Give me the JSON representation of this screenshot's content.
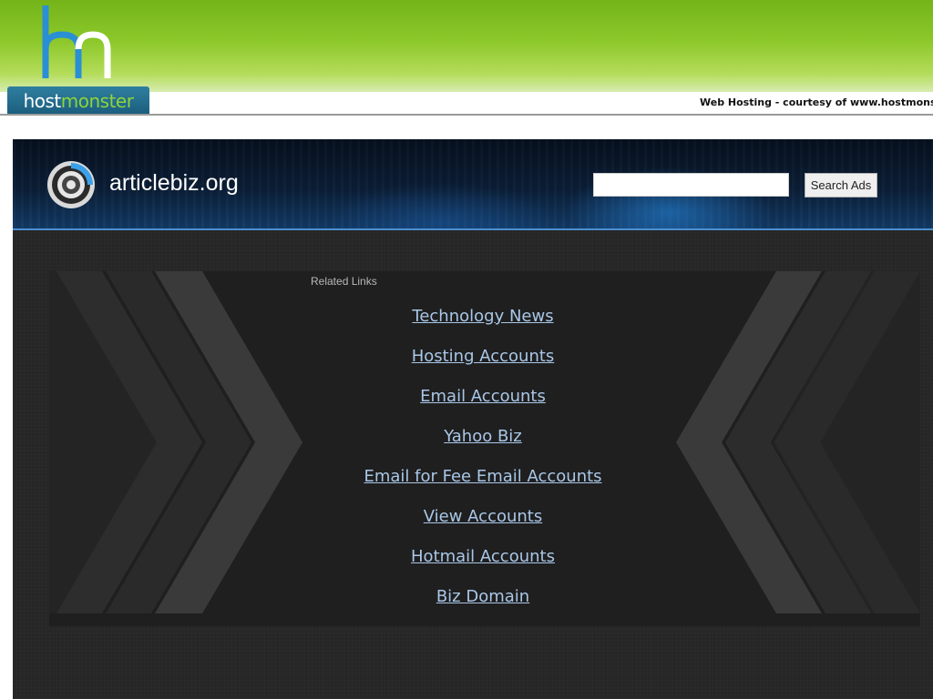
{
  "host_banner": {
    "logo_word_host": "host",
    "logo_word_monster": "monster",
    "logo_mark": "hm-logo-mark",
    "courtesy_text": "Web Hosting - courtesy of www.hostmonster.com",
    "colors": {
      "green": "#8cc82a",
      "logo_box": "#1a5c7c",
      "mark_blue": "#2a8fd4"
    }
  },
  "site": {
    "domain": "articlebiz.org",
    "logo_icon": "target-ring-icon",
    "search": {
      "value": "",
      "placeholder": "",
      "button_label": "Search Ads"
    }
  },
  "related": {
    "title": "Related Links",
    "links": [
      "Technology News",
      "Hosting Accounts",
      "Email Accounts",
      "Yahoo Biz",
      "Email for Fee Email Accounts",
      "View Accounts",
      "Hotmail Accounts",
      "Biz Domain"
    ],
    "link_color": "#a9c7e8"
  }
}
